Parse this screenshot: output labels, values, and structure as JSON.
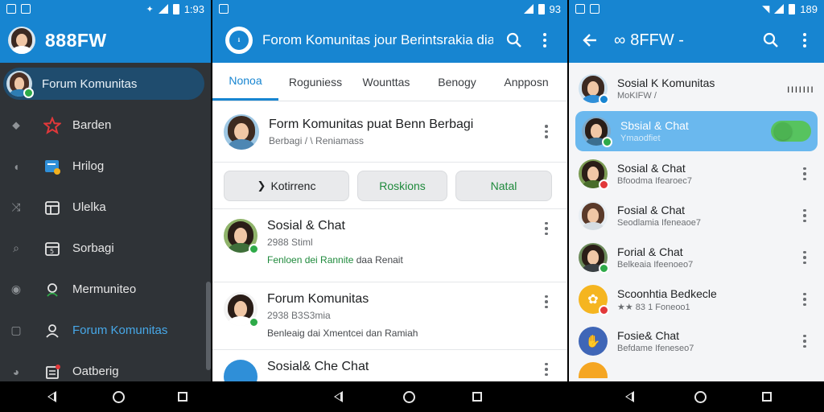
{
  "colors": {
    "primary": "#1785d1",
    "drawer_bg": "#2f3337",
    "drawer_active_bg": "#1f4c6e",
    "drawer_highlight_text": "#47a8e8",
    "success": "#1f8a3c",
    "selected_row": "#6ab8ee",
    "toggle_on": "#57c35f"
  },
  "status_bars": [
    {
      "time": "1:93"
    },
    {
      "time": "93"
    },
    {
      "time": "189"
    }
  ],
  "drawer": {
    "app_title": "888FW",
    "active_item": {
      "label": "Forum Komunitas",
      "icon": "avatar-icon"
    },
    "items": [
      {
        "label": "Barden",
        "icon": "star-icon"
      },
      {
        "label": "Hrilog",
        "icon": "note-icon"
      },
      {
        "label": "Ulelka",
        "icon": "calendar-icon"
      },
      {
        "label": "Sorbagi",
        "icon": "document-icon"
      },
      {
        "label": "Mermuniteo",
        "icon": "location-icon"
      },
      {
        "label": "Forum Komunitas",
        "icon": "user-settings-icon",
        "highlight": true
      },
      {
        "label": "Oatberig",
        "icon": "list-badge-icon"
      }
    ]
  },
  "feed": {
    "app_title": "Forom Komunitas jour Berintsrakia dia",
    "tabs": [
      "Nonoa",
      "Roguniess",
      "Wounttas",
      "Benogy",
      "Anpposn"
    ],
    "active_tab": 0,
    "header_card": {
      "title": "Form Komunitas puat Benn Berbagi",
      "subtitle": "Berbagi / \\ Reniamass"
    },
    "chips": [
      {
        "label": "Kotirrenc",
        "icon": "chevron-right-icon"
      },
      {
        "label": "Roskions"
      },
      {
        "label": "Natal"
      }
    ],
    "posts": [
      {
        "title": "Sosial & Chat",
        "meta": "2988 Stiml",
        "desc_green": "Fenloen dei Rannite",
        "desc_rest": " daa Renait"
      },
      {
        "title": "Forum Komunitas",
        "meta": "2938 B3S3mia",
        "desc_green": "",
        "desc_rest": "Benleaig dai Xmentcei dan Ramiah"
      },
      {
        "title": "Sosial& Che Chat",
        "meta": "",
        "desc_green": "",
        "desc_rest": ""
      }
    ]
  },
  "chat_list": {
    "app_title": "8FFW -",
    "rows": [
      {
        "title": "Sosial K  Komunitas",
        "sub": "MoKIFW /",
        "trailing": "ııııııı",
        "badge": "blue"
      },
      {
        "title": "Sbsial & Chat",
        "sub": "Ymaodfiet",
        "selected": true,
        "toggle_on": true,
        "badge": "green"
      },
      {
        "title": "Sosial & Chat",
        "sub": "Bfoodma Ifearoec7",
        "badge": "red"
      },
      {
        "title": "Fosial & Chat",
        "sub": "Seodlamia Ifeneaoe7",
        "badge": "none"
      },
      {
        "title": "Forial & Chat",
        "sub": "Belkeaia Ifeenoeo7",
        "badge": "green"
      },
      {
        "title": "Scoonhtia Bedkecle",
        "sub": "★★ 83 1 Foneoo1",
        "badge": "red"
      },
      {
        "title": "Fosie& Chat",
        "sub": "Befdame Ifeneseo7",
        "badge": "none"
      }
    ]
  },
  "navigation": {
    "back": "back-icon",
    "home": "home-icon",
    "recents": "recents-icon"
  }
}
